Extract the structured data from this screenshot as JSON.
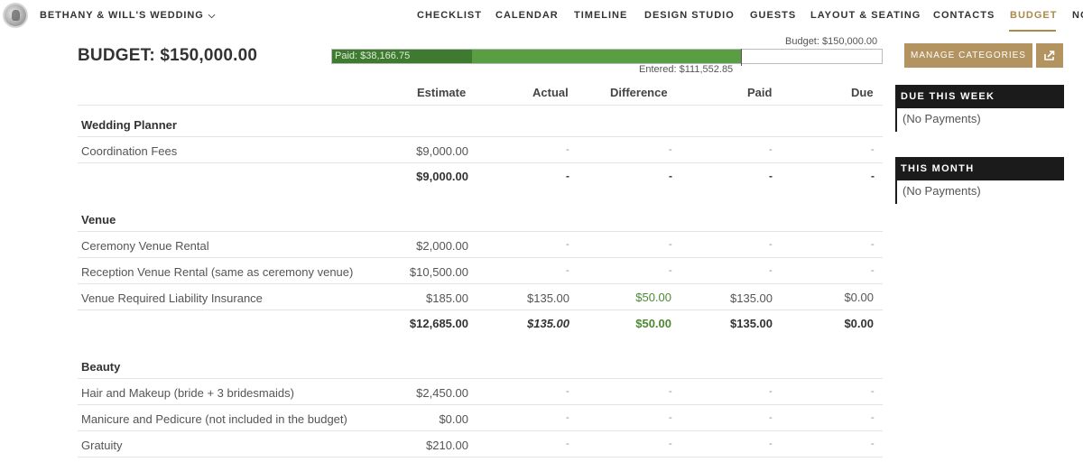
{
  "nav": {
    "brand": "BETHANY & WILL'S WEDDING",
    "links": [
      "CHECKLIST",
      "CALENDAR",
      "TIMELINE",
      "DESIGN STUDIO",
      "GUESTS",
      "LAYOUT & SEATING",
      "CONTACTS",
      "BUDGET",
      "NO"
    ],
    "active": "BUDGET"
  },
  "budget": {
    "title": "BUDGET: $150,000.00",
    "budget_label": "Budget: $150,000.00",
    "paid_label": "Paid: $38,166.75",
    "entered_label": "Entered: $111,552.85",
    "paid_fraction": 0.2544,
    "entered_fraction": 0.7437
  },
  "buttons": {
    "manage_categories": "MANAGE CATEGORIES"
  },
  "columns": {
    "estimate": "Estimate",
    "actual": "Actual",
    "difference": "Difference",
    "paid": "Paid",
    "due": "Due"
  },
  "categories": [
    {
      "name": "Wedding Planner",
      "items": [
        {
          "label": "Coordination Fees",
          "estimate": "$9,000.00",
          "actual": "-",
          "difference": "-",
          "paid": "-",
          "due": "-"
        }
      ],
      "total": {
        "estimate": "$9,000.00",
        "actual": "-",
        "difference": "-",
        "paid": "-",
        "due": "-"
      }
    },
    {
      "name": "Venue",
      "items": [
        {
          "label": "Ceremony Venue Rental",
          "estimate": "$2,000.00",
          "actual": "-",
          "difference": "-",
          "paid": "-",
          "due": "-"
        },
        {
          "label": "Reception Venue Rental (same as ceremony venue)",
          "estimate": "$10,500.00",
          "actual": "-",
          "difference": "-",
          "paid": "-",
          "due": "-"
        },
        {
          "label": "Venue Required Liability Insurance",
          "estimate": "$185.00",
          "actual": "$135.00",
          "difference": "$50.00",
          "paid": "$135.00",
          "due": "$0.00"
        }
      ],
      "total": {
        "estimate": "$12,685.00",
        "actual": "$135.00",
        "difference": "$50.00",
        "paid": "$135.00",
        "due": "$0.00"
      }
    },
    {
      "name": "Beauty",
      "items": [
        {
          "label": "Hair and Makeup (bride + 3 bridesmaids)",
          "estimate": "$2,450.00",
          "actual": "-",
          "difference": "-",
          "paid": "-",
          "due": "-"
        },
        {
          "label": "Manicure and Pedicure (not included in the budget)",
          "estimate": "$0.00",
          "actual": "-",
          "difference": "-",
          "paid": "-",
          "due": "-"
        },
        {
          "label": "Gratuity",
          "estimate": "$210.00",
          "actual": "-",
          "difference": "-",
          "paid": "-",
          "due": "-"
        }
      ]
    }
  ],
  "panels": {
    "due_this_week": {
      "title": "DUE THIS WEEK",
      "body": "(No Payments)"
    },
    "this_month": {
      "title": "THIS MONTH",
      "body": "(No Payments)"
    }
  },
  "colors": {
    "accent": "#a88a4b",
    "button": "#b39460",
    "paid_bar": "#3f7a31",
    "entered_bar": "#5a9e44",
    "difference_text": "#4a8a32",
    "panel_header": "#1b1b1b"
  },
  "icons": {
    "avatar": "wedding-couple-photo",
    "brand_dropdown": "chevron-down-icon",
    "export": "export-icon"
  }
}
